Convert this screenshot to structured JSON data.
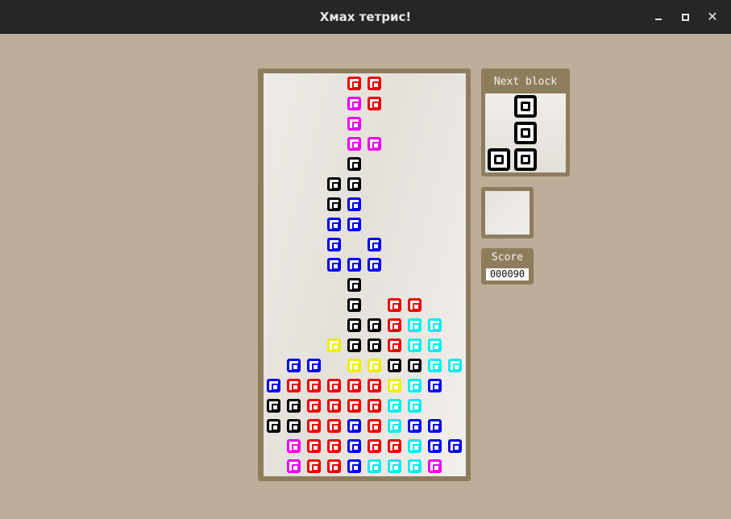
{
  "window": {
    "title": "Xмах тетрис!",
    "buttons": [
      "minimize-icon",
      "maximize-icon",
      "close-icon"
    ]
  },
  "colors": {
    "R": "#ee0000",
    "M": "#ee00ee",
    "K": "#000000",
    "B": "#0000ee",
    "C": "#00eeee",
    "Y": "#eeee00",
    "background": "#bcae98",
    "frame": "#8e7d5c",
    "titlebar": "#262626"
  },
  "board": {
    "columns": 10,
    "rows": 20,
    "grid": [
      "....RR....",
      "....MR....",
      "....M.....",
      "....MM....",
      "....K.....",
      "...KK.....",
      "...KB.....",
      "...BB.....",
      "...B.B....",
      "...BBB....",
      "....K.....",
      "....K.RR..",
      "....KKRCC.",
      "...YKKRCC.",
      ".BB.YYKKCC",
      "BRRRRRYCB.",
      "KKRRRRCC..",
      "KKRRBRCBB.",
      ".MRRBRRCBB",
      ".MRRBCCCM."
    ]
  },
  "next": {
    "label": "Next block",
    "grid": [
      ".K",
      ".K",
      "KK"
    ]
  },
  "hold": {
    "grid": []
  },
  "score": {
    "label": "Score",
    "value": "000090"
  }
}
